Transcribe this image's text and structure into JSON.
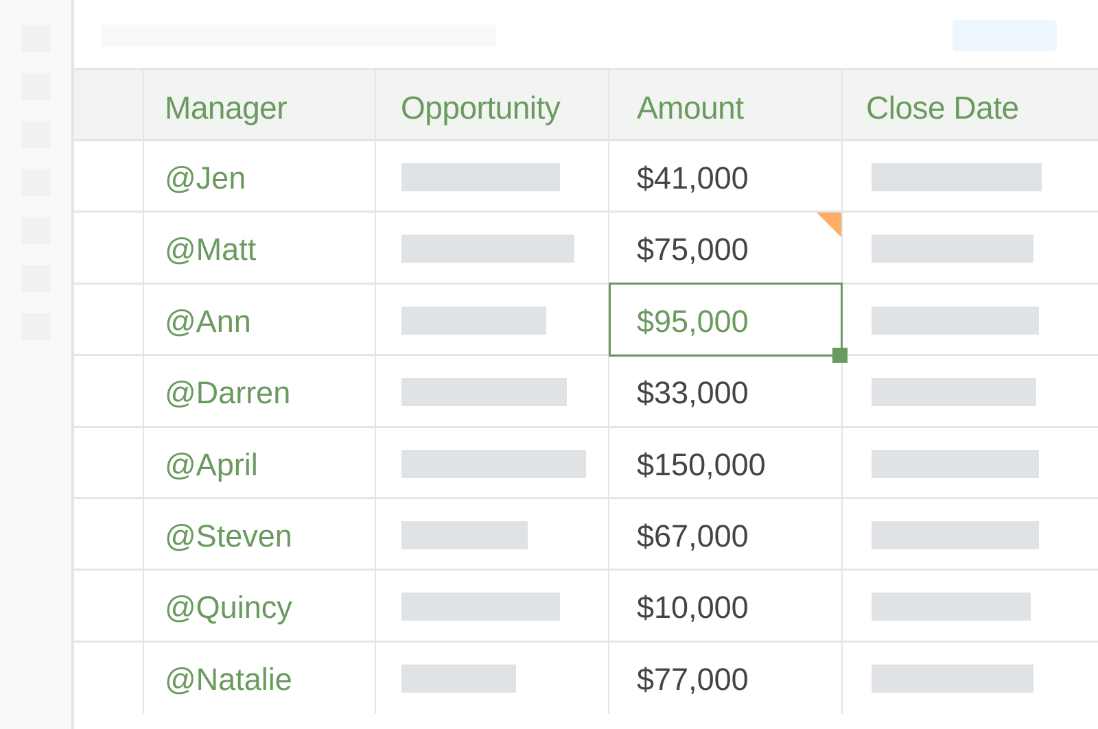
{
  "colors": {
    "accent_green": "#6a9a5e",
    "amount_text": "#444444",
    "comment_flag": "#fdad65",
    "placeholder": "#e0e3e6",
    "header_bg": "#f2f4f2",
    "button_bg": "#edf7fd"
  },
  "sidebar": {
    "item_count": 7
  },
  "table": {
    "columns": [
      "",
      "Manager",
      "Opportunity",
      "Amount",
      "Close Date"
    ],
    "rows": [
      {
        "manager": "@Jen",
        "amount": "$41,000",
        "opportunity_placeholder_fraction": 0.68,
        "close_date_placeholder_fraction": 0.62
      },
      {
        "manager": "@Matt",
        "amount": "$75,000",
        "opportunity_placeholder_fraction": 0.74,
        "close_date_placeholder_fraction": 0.59,
        "amount_has_comment": true
      },
      {
        "manager": "@Ann",
        "amount": "$95,000",
        "opportunity_placeholder_fraction": 0.62,
        "close_date_placeholder_fraction": 0.61,
        "amount_selected": true
      },
      {
        "manager": "@Darren",
        "amount": "$33,000",
        "opportunity_placeholder_fraction": 0.71,
        "close_date_placeholder_fraction": 0.6
      },
      {
        "manager": "@April",
        "amount": "$150,000",
        "opportunity_placeholder_fraction": 0.79,
        "close_date_placeholder_fraction": 0.61
      },
      {
        "manager": "@Steven",
        "amount": "$67,000",
        "opportunity_placeholder_fraction": 0.54,
        "close_date_placeholder_fraction": 0.61
      },
      {
        "manager": "@Quincy",
        "amount": "$10,000",
        "opportunity_placeholder_fraction": 0.68,
        "close_date_placeholder_fraction": 0.58
      },
      {
        "manager": "@Natalie",
        "amount": "$77,000",
        "opportunity_placeholder_fraction": 0.49,
        "close_date_placeholder_fraction": 0.59
      }
    ]
  }
}
